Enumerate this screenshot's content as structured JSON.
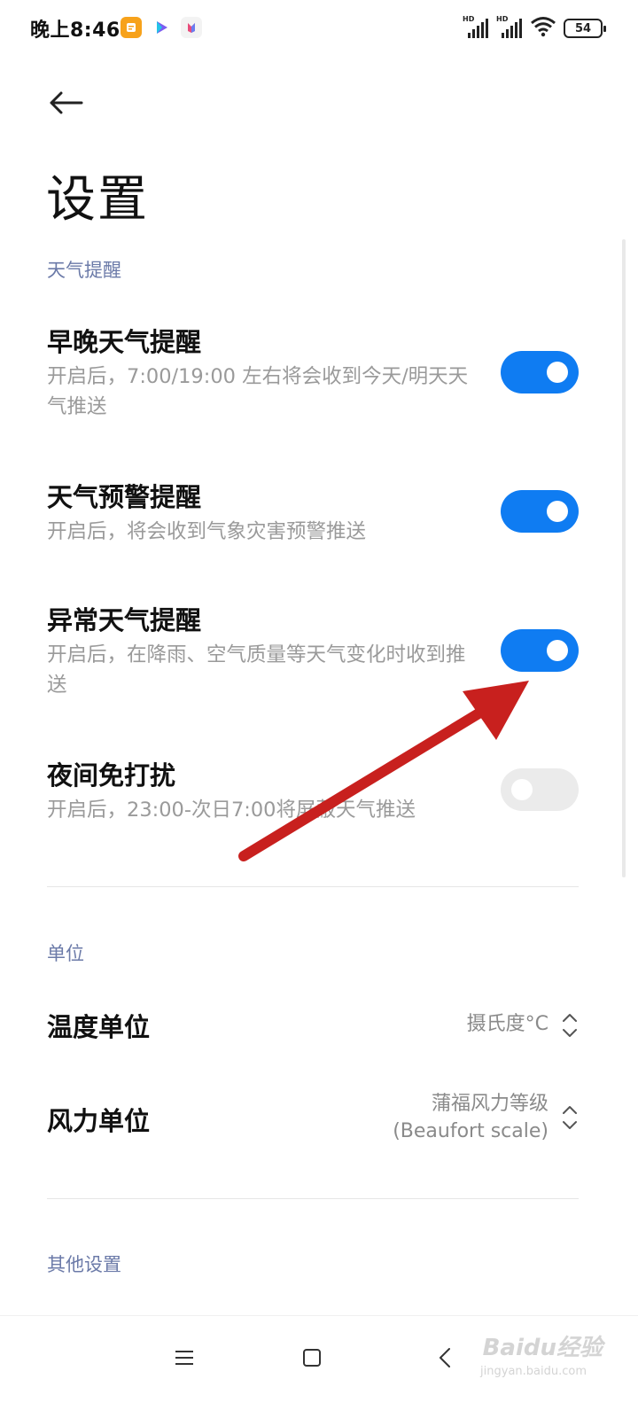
{
  "status_bar": {
    "time": "晚上8:46",
    "hd_label": "HD",
    "battery": "54"
  },
  "header": {
    "title": "设置"
  },
  "sections": {
    "weather_alerts": {
      "title": "天气提醒",
      "items": [
        {
          "title": "早晚天气提醒",
          "desc": "开启后，7:00/19:00 左右将会收到今天/明天天气推送",
          "enabled": true
        },
        {
          "title": "天气预警提醒",
          "desc": "开启后，将会收到气象灾害预警推送",
          "enabled": true
        },
        {
          "title": "异常天气提醒",
          "desc": "开启后，在降雨、空气质量等天气变化时收到推送",
          "enabled": true
        },
        {
          "title": "夜间免打扰",
          "desc": "开启后，23:00-次日7:00将屏蔽天气推送",
          "enabled": false
        }
      ]
    },
    "units": {
      "title": "单位",
      "temperature": {
        "title": "温度单位",
        "value": "摄氏度°C"
      },
      "wind": {
        "title": "风力单位",
        "value_line1": "蒲福风力等级",
        "value_line2": "(Beaufort scale)"
      }
    },
    "other": {
      "title": "其他设置"
    }
  },
  "watermark": {
    "brand": "Baidu经验",
    "url": "jingyan.baidu.com"
  },
  "colors": {
    "toggle_on": "#0f7cf2",
    "toggle_off": "#ebebeb",
    "section_title": "#6b7aa8",
    "annotation_arrow": "#c8201e"
  }
}
